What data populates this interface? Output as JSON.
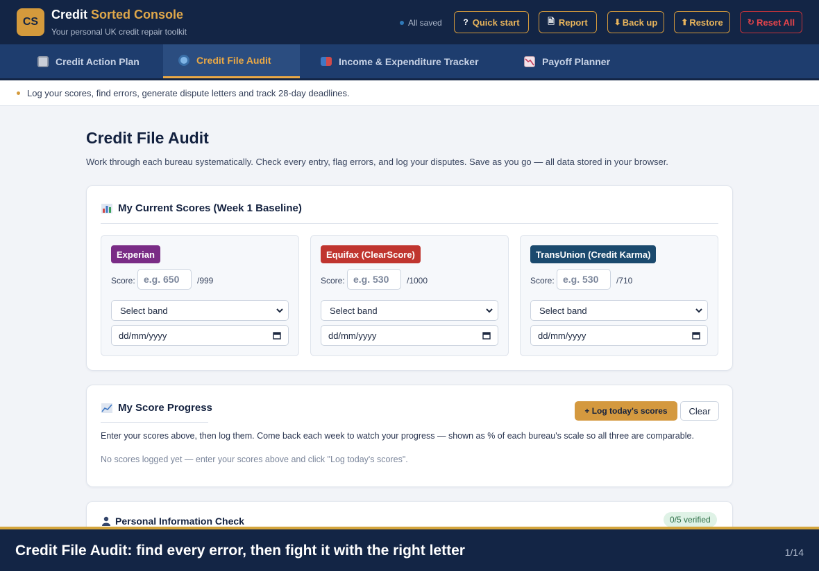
{
  "app": {
    "logo": "CS",
    "title_main": "Credit",
    "title_accent": "Sorted Console",
    "subtitle": "Your personal UK credit repair toolkit",
    "save_status": "All saved"
  },
  "header_buttons": [
    {
      "icon": "question-icon",
      "glyph": "?",
      "label": "Quick start"
    },
    {
      "icon": "document-icon",
      "glyph": "🗎",
      "label": "Report"
    },
    {
      "icon": "download-arrow-icon",
      "glyph": "⬇",
      "label": "Back up"
    },
    {
      "icon": "upload-arrow-icon",
      "glyph": "⬆",
      "label": "Restore"
    },
    {
      "icon": "reset-icon",
      "glyph": "↻",
      "label": "Reset All"
    }
  ],
  "tabs": [
    {
      "label": "Credit Action Plan",
      "icon": "clipboard-icon",
      "active": false
    },
    {
      "label": "Credit File Audit",
      "icon": "magnifier-icon",
      "active": true
    },
    {
      "label": "Income & Expenditure Tracker",
      "icon": "book-icon",
      "active": false
    },
    {
      "label": "Payoff Planner",
      "icon": "chart-down-icon",
      "active": false
    }
  ],
  "info_bar": "Log your scores, find errors, generate dispute letters and track 28-day deadlines.",
  "page": {
    "title": "Credit File Audit",
    "description": "Work through each bureau systematically. Check every entry, flag errors, and log your disputes. Save as you go — all data stored in your browser."
  },
  "scores_card": {
    "heading": "My Current Scores (Week 1 Baseline)",
    "score_label": "Score:",
    "bureaus": [
      {
        "name": "Experian",
        "color": "#7a2c86",
        "placeholder": "e.g. 650",
        "max": "/999",
        "band": "Select band",
        "date": "dd/mm/yyyy"
      },
      {
        "name": "Equifax (ClearScore)",
        "color": "#c0352f",
        "placeholder": "e.g. 530",
        "max": "/1000",
        "band": "Select band",
        "date": "dd/mm/yyyy"
      },
      {
        "name": "TransUnion (Credit Karma)",
        "color": "#1b4a6e",
        "placeholder": "e.g. 530",
        "max": "/710",
        "band": "Select band",
        "date": "dd/mm/yyyy"
      }
    ]
  },
  "progress_card": {
    "heading": "My Score Progress",
    "log_button": "+ Log today's scores",
    "clear_button": "Clear",
    "help": "Enter your scores above, then log them. Come back each week to watch your progress — shown as % of each bureau's scale so all three are comparable.",
    "empty": "No scores logged yet — enter your scores above and click \"Log today's scores\"."
  },
  "personal_card": {
    "heading": "Personal Information Check",
    "verified": "0/5 verified"
  },
  "caption": {
    "text": "Credit File Audit: find every error, then fight it with the right letter",
    "page": "1/14"
  },
  "colors": {
    "navy": "#132545",
    "accent": "#d49a3c",
    "danger": "#c5333a"
  }
}
